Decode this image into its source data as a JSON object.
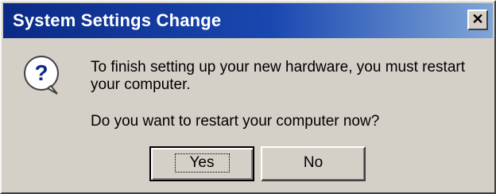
{
  "window": {
    "title": "System Settings Change",
    "close_symbol": "✕"
  },
  "icon": {
    "name": "question-icon",
    "glyph": "?"
  },
  "message": {
    "line1": "To finish setting up your new hardware, you must restart your computer.",
    "line2": "Do you want to restart your computer now?"
  },
  "buttons": {
    "yes_label": "Yes",
    "no_label": "No"
  },
  "colors": {
    "titlebar_start": "#0b2a86",
    "titlebar_end": "#7fa6d8",
    "face": "#d4d0c8"
  }
}
